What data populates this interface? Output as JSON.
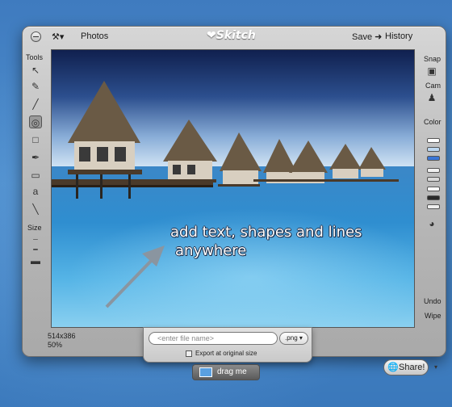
{
  "window": {
    "menu_icon": "tools-icon",
    "photos_label": "Photos",
    "logo_text": "Skitch",
    "save_label": "Save",
    "history_label": "History"
  },
  "left_panel": {
    "tools_label": "Tools",
    "size_label": "Size",
    "tools": [
      {
        "name": "pointer-icon",
        "glyph": "↖"
      },
      {
        "name": "pencil-icon",
        "glyph": "✎"
      },
      {
        "name": "line-icon",
        "glyph": "╱"
      },
      {
        "name": "ellipse-icon",
        "glyph": "◎"
      },
      {
        "name": "rectangle-icon",
        "glyph": "□"
      },
      {
        "name": "highlighter-icon",
        "glyph": "✒"
      },
      {
        "name": "eraser-icon",
        "glyph": "▭"
      },
      {
        "name": "text-icon",
        "glyph": "a"
      },
      {
        "name": "brush-icon",
        "glyph": "╲"
      }
    ]
  },
  "right_panel": {
    "snap_label": "Snap",
    "cam_label": "Cam",
    "color_label": "Color",
    "undo_label": "Undo",
    "wipe_label": "Wipe",
    "swatches": [
      "#ffffff",
      "#bcd7f0",
      "#3a76d6",
      "#f0f0f0",
      "#d8d8d8",
      "#ffffff",
      "#2a2a2a",
      "#eeeeee"
    ]
  },
  "canvas": {
    "annotation_text_line1": "add text, shapes and lines",
    "annotation_text_line2": "anywhere"
  },
  "status": {
    "dimensions": "514x386",
    "zoom": "50%"
  },
  "file_panel": {
    "filename_placeholder": "<enter file name>",
    "filetype": ".png",
    "export_label": "Export at original size"
  },
  "share": {
    "label": "Share!"
  },
  "drag": {
    "label": "drag me"
  }
}
